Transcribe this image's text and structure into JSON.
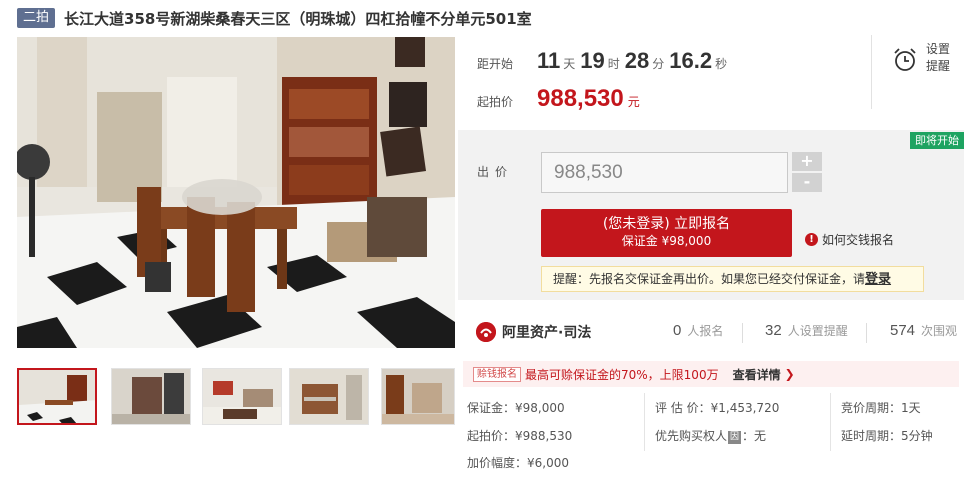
{
  "title": {
    "round": "二拍",
    "text": "长江大道358号新湖柴桑春天三区（明珠城）四杠拾幢不分单元501室"
  },
  "countdown": {
    "label": "距开始",
    "days": "11",
    "days_unit": "天",
    "hours": "19",
    "hours_unit": "时",
    "minutes": "28",
    "minutes_unit": "分",
    "seconds": "16.2",
    "seconds_unit": "秒"
  },
  "start_price": {
    "label": "起拍价",
    "value": "988,530",
    "unit": "元"
  },
  "reminder": {
    "label": "设置提醒",
    "icon": "alarm-clock-icon"
  },
  "status_badge": "即将开始",
  "bid": {
    "label": "出价",
    "value": "988,530",
    "increase": "+",
    "decrease": "-"
  },
  "signup": {
    "main": "(您未登录) 立即报名",
    "sub": "保证金 ¥98,000"
  },
  "howto": {
    "text": "如何交钱报名",
    "icon": "info-icon"
  },
  "tip": {
    "text": "提醒：先报名交保证金再出价。如果您已经交付保证金，请",
    "link": "登录"
  },
  "platform": {
    "name": "阿里资产·司法",
    "icon": "ali-asset-logo-icon"
  },
  "stats": [
    {
      "num": "0",
      "label": "人报名"
    },
    {
      "num": "32",
      "label": "人设置提醒"
    },
    {
      "num": "574",
      "label": "次围观"
    }
  ],
  "promo": {
    "tag": "赊钱报名",
    "text": "最高可赊保证金的70%，上限100万",
    "link": "查看详情"
  },
  "details": {
    "deposit": "保证金：¥98,000",
    "appraisal": "评 估 价：¥1,453,720",
    "cycle": "竞价周期：1天",
    "start": "起拍价：¥988,530",
    "priority_prefix": "优先购买权人",
    "priority_tag": "因",
    "priority_value": "：无",
    "delay": "延时周期：5分钟",
    "increment": "加价幅度：¥6,000"
  },
  "colors": {
    "accent": "#c3161c",
    "badge_green": "#1ea361",
    "round_badge": "#5f6f91"
  }
}
